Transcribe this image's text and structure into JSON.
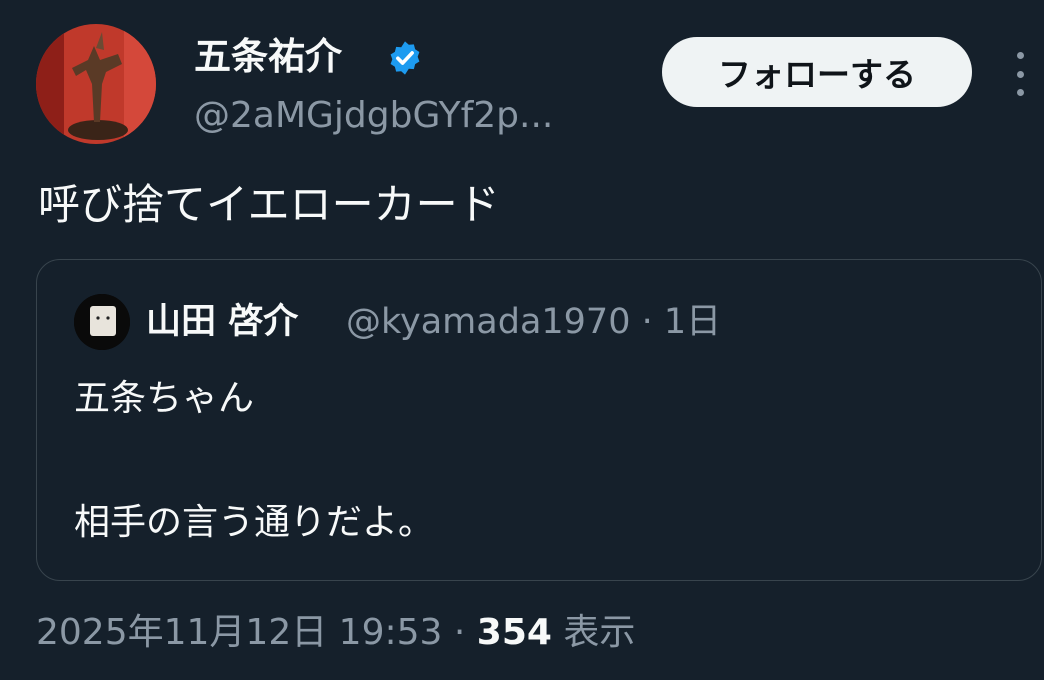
{
  "author": {
    "display_name": "五条祐介",
    "handle": "@2aMGjdgbGYf2p...",
    "verified_color": "#1d9bf0"
  },
  "follow_button_label": "フォローする",
  "tweet_text": "呼び捨てイエローカード",
  "quoted_tweet": {
    "display_name": "山田 啓介",
    "handle": "@kyamada1970",
    "separator": "·",
    "age": "1日",
    "text_lines": [
      "五条ちゃん",
      "相手の言う通りだよ。"
    ]
  },
  "timestamp": {
    "date_time": "2025年11月12日 19:53",
    "separator": "·",
    "views_count": "354",
    "views_label": "表示"
  },
  "icons": {
    "verified": "verified-badge-icon",
    "more": "more-options-icon"
  },
  "colors": {
    "background": "#15202b",
    "muted_text": "#8b98a5",
    "border": "#38444d",
    "button_bg": "#eff3f4"
  }
}
